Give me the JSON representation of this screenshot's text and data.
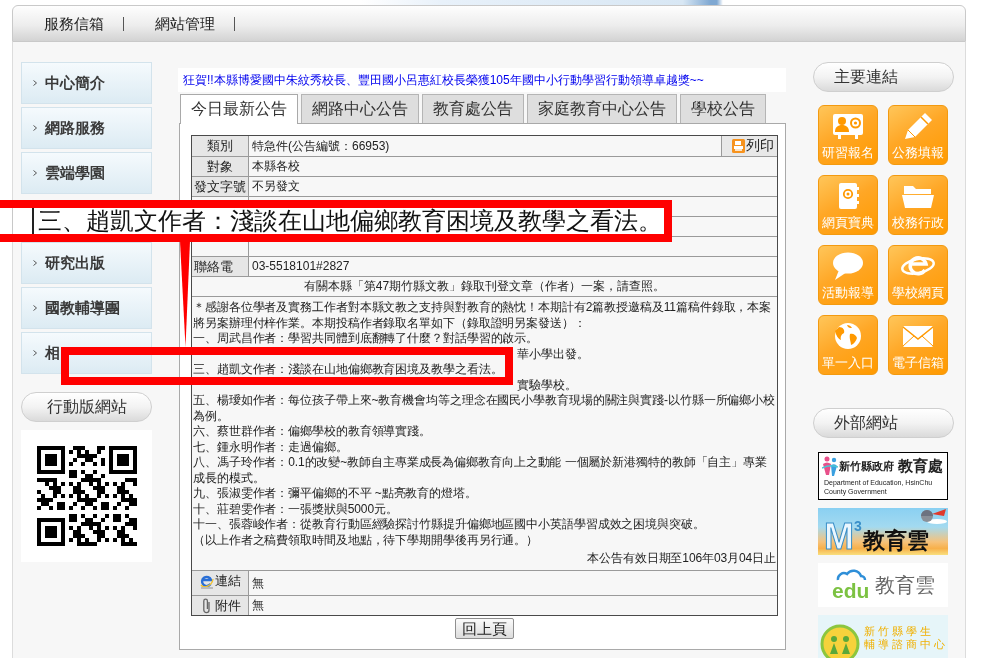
{
  "nav": [
    {
      "label": "服務信箱"
    },
    {
      "label": "網站管理"
    }
  ],
  "sidebar": {
    "items": [
      {
        "kind": "link",
        "label": "中心簡介"
      },
      {
        "kind": "link",
        "label": "網路服務"
      },
      {
        "kind": "link",
        "label": "雲端學園"
      },
      {
        "kind": "covered"
      },
      {
        "kind": "link",
        "label": "研究出版"
      },
      {
        "kind": "link",
        "label": "國教輔導團"
      },
      {
        "kind": "link",
        "label": "相"
      }
    ],
    "mobile_site": {
      "title": "行動版網站"
    }
  },
  "ticker": "狂賀!!本縣博愛國中朱紋秀校長、豐田國小呂惠紅校長榮獲105年國中小行動學習行動領導卓越獎~~",
  "tabs": [
    {
      "label": "今日最新公告",
      "selected": true
    },
    {
      "label": "網路中心公告",
      "selected": false
    },
    {
      "label": "教育處公告",
      "selected": false
    },
    {
      "label": "家庭教育中心公告",
      "selected": false
    },
    {
      "label": "學校公告",
      "selected": false
    }
  ],
  "announcement": {
    "rows": [
      {
        "kind": "field",
        "label": "類別",
        "value": "特急件(公告編號：66953)"
      },
      {
        "kind": "field",
        "label": "對象",
        "value": "本縣各校"
      },
      {
        "kind": "field",
        "label": "發文字號",
        "value": "不另發文"
      },
      {
        "kind": "covered"
      },
      {
        "kind": "covered"
      },
      {
        "kind": "covered"
      },
      {
        "kind": "clipped",
        "label": "聯絡電",
        "value": "03-5518101#2827"
      }
    ],
    "print_button": "列印",
    "subject": "有關本縣「第47期竹縣文教」錄取刊登文章（作者）一案，請查照。",
    "body": [
      {
        "kind": "line",
        "text": "＊感謝各位學者及實務工作者對本縣文教之支持與對教育的熱忱！本期計有2篇教授邀稿及11篇稿件錄取，本案將另案辦理付梓作業。本期投稿作者錄取名單如下（錄取證明另案發送）："
      },
      {
        "kind": "line",
        "text": "一、周武昌作者：學習共同體到底翻轉了什麼？對話學習的啟示。"
      },
      {
        "kind": "clipped",
        "text": "華小學出發。"
      },
      {
        "kind": "line",
        "text": "三、趙凱文作者：淺談在山地偏鄉教育困境及教學之看法。"
      },
      {
        "kind": "clipped",
        "text": "實驗學校。"
      },
      {
        "kind": "line",
        "text": "五、楊璦如作者：每位孩子帶上來~教育機會均等之理念在國民小學教育現場的關注與實踐-以竹縣一所偏鄉小校為例。"
      },
      {
        "kind": "line",
        "text": "六、蔡世群作者：偏鄉學校的教育領導實踐。"
      },
      {
        "kind": "line",
        "text": "七、鍾永明作者：走過偏鄉。"
      },
      {
        "kind": "line",
        "text": "八、馮子玲作者：0.1的改變~教師自主專業成長為偏鄉教育向上之動能 一個屬於新港獨特的教師「自主」專業成長的模式。"
      },
      {
        "kind": "line",
        "text": "九、張淑雯作者：彌平偏鄉的不平 ~點亮教育的燈塔。"
      },
      {
        "kind": "line",
        "text": "十、莊碧雯作者：一張獎狀與5000元。"
      },
      {
        "kind": "line",
        "text": "十一、張蓉峻作者：從教育行動區經驗探討竹縣提升偏鄉地區國中小英語學習成效之困境與突破。"
      },
      {
        "kind": "line",
        "text": "（以上作者之稿費領取時間及地點，待下學期開學後再另行通。）"
      }
    ],
    "validity": "本公告有效日期至106年03月04日止",
    "extras": [
      {
        "kind": "link",
        "label": "連結",
        "value": "無"
      },
      {
        "kind": "attachment",
        "label": "附件",
        "value": "無"
      }
    ],
    "back_button": "回上頁"
  },
  "main_links": {
    "title": "主要連結",
    "tiles": [
      {
        "label": "研習報名"
      },
      {
        "label": "公務填報"
      },
      {
        "label": "網頁寶典"
      },
      {
        "label": "校務行政"
      },
      {
        "label": "活動報導"
      },
      {
        "label": "學校網頁"
      },
      {
        "label": "單一入口"
      },
      {
        "label": "電子信箱"
      }
    ]
  },
  "external_sites": {
    "title": "外部網站",
    "banners": [
      {
        "kind": "county",
        "title": "新竹縣政府",
        "subtitle": "教育處",
        "caption": "Department of Education, HsinChu County Government"
      },
      {
        "kind": "m3",
        "logo": "M$^{3}$",
        "title": "教育雲"
      },
      {
        "kind": "edu",
        "logo": "edu",
        "title": "教育雲"
      },
      {
        "kind": "counseling",
        "lines": [
          "新竹縣學生",
          "輔導諮商中心"
        ]
      }
    ]
  },
  "callout": {
    "text": "三、趙凱文作者：淺談在山地偏鄉教育困境及教學之看法。"
  }
}
